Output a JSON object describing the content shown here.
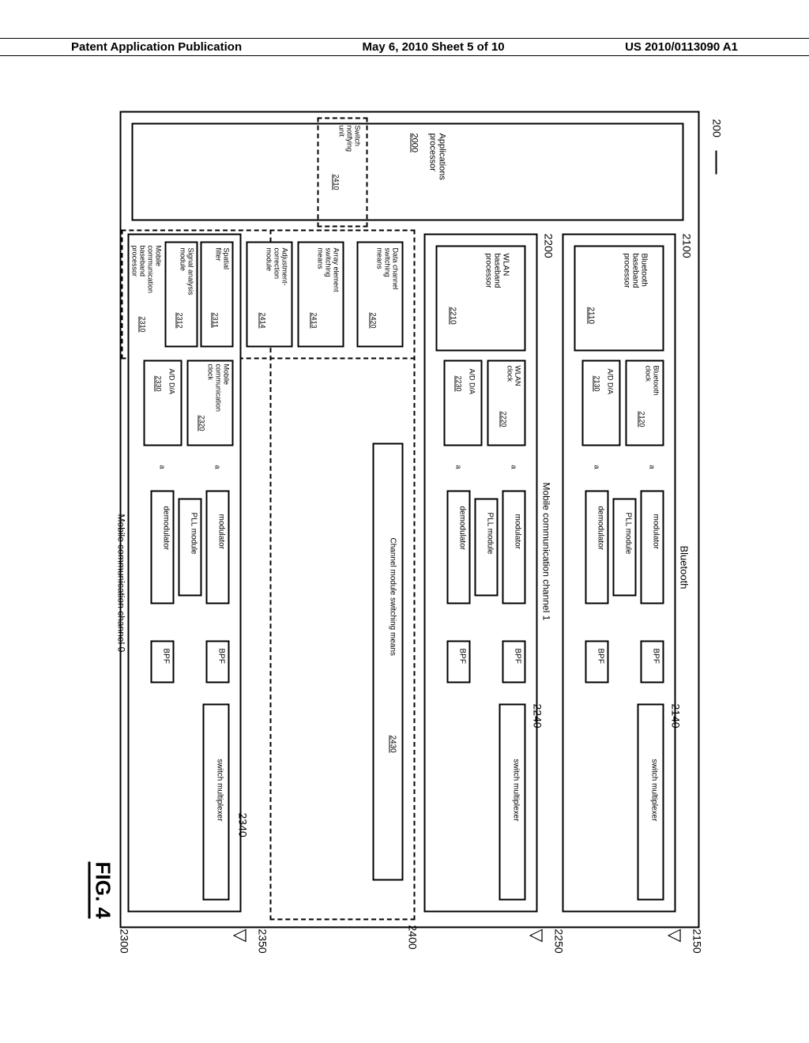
{
  "header": {
    "left": "Patent Application Publication",
    "center": "May 6, 2010  Sheet 5 of 10",
    "right": "US 2010/0113090 A1"
  },
  "refs": {
    "main": "200",
    "app_proc": "2000",
    "bt_group": "2100",
    "bt_bb": "2110",
    "bt_clk": "2120",
    "bt_ad": "2130",
    "bt_mux": "2140",
    "bt_ant": "2150",
    "wlan_group": "2200",
    "wlan_bb": "2210",
    "wlan_clk": "2220",
    "wlan_ad": "2230",
    "wlan_mux": "2240",
    "wlan_ant": "2250",
    "switch_unit": "2410",
    "data_sw": "2420",
    "ch_sw": "2430",
    "dev": "2400",
    "arr_sw": "2413",
    "adj": "2414",
    "spatial": "2311",
    "sig": "2312",
    "mc_bb": "2310",
    "mc_clk": "2320",
    "mc_ad": "2330",
    "mc_mux": "2340",
    "mc_ant": "2350",
    "mc_group": "2300"
  },
  "labels": {
    "app_proc": "Applications\nprocessor",
    "switch_unit": "Switch\nnotifying\nunit",
    "bt_title": "Bluetooth",
    "bt_bb": "Bluetooth\nbaseband\nprocessor",
    "bt_clk": "Bluetooth\nclock",
    "ad": "A/D  D/A",
    "mod": "modulator",
    "demod": "demodulator",
    "pll": "PLL module",
    "bpf": "BPF",
    "sw_mux": "switch multiplexer",
    "wlan_title": "Mobile communication channel 1",
    "wlan_bb": "WLAN\nbaseband\nprocessor",
    "wlan_clk": "WLAN\nclock",
    "data_sw": "Data channel\nswitching\nmeans",
    "ch_sw": "Channel module switching means",
    "arr_sw": "Array element\nswitching\nmeans",
    "adj": "Adjustment-\ncorrection\nmodule",
    "spatial": "Spatial\nfilter",
    "sig": "Signal analysis\nmodule",
    "mc_bb": "Mobile\ncommunication\nbaseband\nprocessor",
    "mc_clk": "Mobile\ncommunication\nclock",
    "mc_title": "Mobile communication channel 0",
    "fig": "FIG. 4",
    "a": "a"
  }
}
